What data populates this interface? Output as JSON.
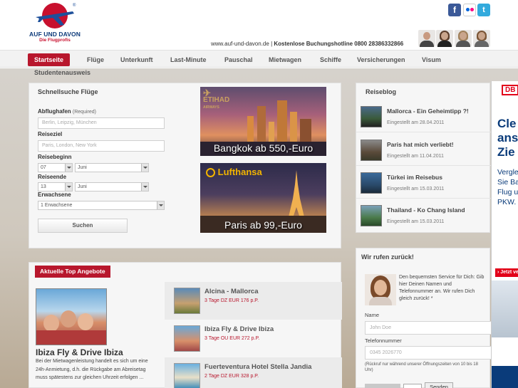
{
  "brand": {
    "name": "AUF UND DAVON",
    "tagline": "Die Flugprofis",
    "registered_mark": "®"
  },
  "social": {
    "facebook": "f",
    "twitter": "t"
  },
  "header": {
    "url": "www.auf-und-davon.de",
    "separator": "|",
    "hotline": "Kostenlose Buchungshotline 0800 28386332866"
  },
  "nav": {
    "items": [
      {
        "label": "Startseite",
        "active": true
      },
      {
        "label": "Flüge"
      },
      {
        "label": "Unterkunft"
      },
      {
        "label": "Last-Minute"
      },
      {
        "label": "Pauschal"
      },
      {
        "label": "Mietwagen"
      },
      {
        "label": "Schiffe"
      },
      {
        "label": "Versicherungen"
      },
      {
        "label": "Visum"
      }
    ],
    "second_row": "Studentenausweis"
  },
  "search": {
    "title": "Schnellsuche Flüge",
    "departure_label": "Abflughafen",
    "required_hint": "(Required)",
    "departure_placeholder": "Berlin, Leipzig, München",
    "destination_label": "Reiseziel",
    "destination_placeholder": "Paris, London, New York",
    "start_label": "Reisebeginn",
    "start_day": "07",
    "start_month": "Juni",
    "end_label": "Reiseende",
    "end_day": "13",
    "end_month": "Juni",
    "adults_label": "Erwachsene",
    "adults_value": "1 Erwachsene",
    "button": "Suchen"
  },
  "ads": {
    "bangkok": {
      "brand": "ETIHAD",
      "brand_sub": "AIRWAYS",
      "caption": "Bangkok ab 550,-Euro"
    },
    "paris": {
      "brand": "Lufthansa",
      "caption": "Paris ab 99,-Euro"
    }
  },
  "offers": {
    "tab": "Aktuelle Top Angebote",
    "featured": {
      "title": "Ibiza Fly & Drive Ibiza",
      "text": "Bei der Mietwagenleistung handelt es sich um eine 24h-Anmietung, d.h. die Rückgabe am Abreisetag muss spätestens zur gleichen Uhrzeit erfolgen ..."
    },
    "items": [
      {
        "title": "Alcina - Mallorca",
        "price": "3 Tage DZ EUR 176 p.P."
      },
      {
        "title": "Ibiza Fly & Drive Ibiza",
        "price": "3 Tage OU EUR 272 p.P."
      },
      {
        "title": "Fuerteventura Hotel Stella Jandia",
        "price": "2 Tage DZ EUR 328 p.P."
      }
    ]
  },
  "blog": {
    "title": "Reiseblog",
    "items": [
      {
        "title": "Mallorca - Ein Geheimtipp ?!",
        "date": "Eingestellt am 28.04.2011"
      },
      {
        "title": "Paris hat mich verliebt!",
        "date": "Eingestellt am 11.04.2011"
      },
      {
        "title": "Türkei im Reisebus",
        "date": "Eingestellt am 15.03.2011"
      },
      {
        "title": "Thailand - Ko Chang Island",
        "date": "Eingestellt am 15.03.2011"
      }
    ]
  },
  "callback": {
    "title": "Wir rufen zurück!",
    "text": "Den bequemsten Service für Dich: Gib hier Deinen Namen und Telefonnummer an. Wir rufen Dich gleich zurück! *",
    "name_label": "Name",
    "name_placeholder": "John Doe",
    "phone_label": "Telefonnummer",
    "phone_placeholder": "0345 2026770",
    "note": "(Rückruf nur während unserer Öffnungszeiten von 10 bis 18 Uhr)",
    "send": "Senden"
  },
  "db_ad": {
    "logo": "DB",
    "headline_1": "Cle",
    "headline_2": "ans",
    "headline_3": "Zie",
    "text_1": "Vergle",
    "text_2": "Sie Ba",
    "text_3": "Flug u",
    "text_4": "PKW.",
    "button": "› Jetzt ve"
  },
  "colors": {
    "accent": "#b8172d",
    "brand_blue": "#0d3a7a",
    "db_red": "#e2001a"
  }
}
